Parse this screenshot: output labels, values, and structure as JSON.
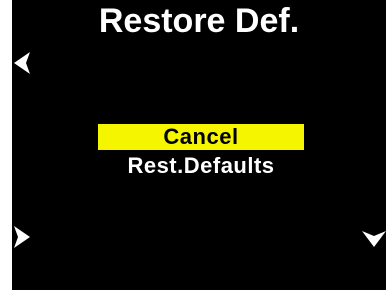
{
  "screen": {
    "title": "Restore Def.",
    "colors": {
      "background": "#000000",
      "text": "#ffffff",
      "highlight": "#f5f500",
      "highlight_text": "#000000"
    }
  },
  "menu": {
    "items": [
      {
        "label": "Cancel",
        "selected": true
      },
      {
        "label": "Rest.Defaults",
        "selected": false
      }
    ]
  },
  "navigation": {
    "icons": [
      "chevron-left-icon",
      "chevron-right-icon",
      "chevron-down-icon"
    ]
  }
}
